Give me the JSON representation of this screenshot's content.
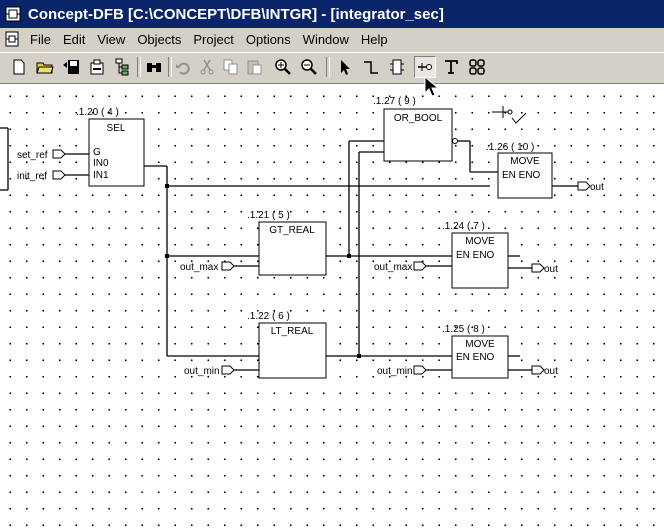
{
  "window": {
    "title": "Concept-DFB [C:\\CONCEPT\\DFB\\INTGR]  - [integrator_sec]"
  },
  "menu": [
    "File",
    "Edit",
    "View",
    "Objects",
    "Project",
    "Options",
    "Window",
    "Help"
  ],
  "toolbar": {
    "buttons": [
      "new-file-icon",
      "open-folder-icon",
      "save-icon",
      "print-setup-icon",
      "hierarchy-icon",
      "find-icon",
      "undo-icon",
      "cut-icon",
      "copy-icon",
      "paste-icon",
      "zoom-in-icon",
      "zoom-out-icon",
      "select-arrow-icon",
      "link-icon",
      "ffb-block-icon",
      "pin-icon",
      "text-icon",
      "grid-icon"
    ],
    "pressed": "pin-icon"
  },
  "blocks": {
    "sel": {
      "id": ".1.20 ( 4 )",
      "name": "SEL",
      "pins": [
        "G",
        "IN0",
        "IN1"
      ]
    },
    "or_bool": {
      "id": ".1.27 ( 9 )",
      "name": "OR_BOOL"
    },
    "move10": {
      "id": ".1.26 ( 10 )",
      "name": "MOVE",
      "pins": "EN ENO"
    },
    "gt_real": {
      "id": ".1.21 ( 5 )",
      "name": "GT_REAL"
    },
    "move7": {
      "id": ".1.24 ( 7 )",
      "name": "MOVE",
      "pins": "EN  ENO"
    },
    "lt_real": {
      "id": ".1.22 ( 6 )",
      "name": "LT_REAL"
    },
    "move8": {
      "id": ".1.25 ( 8 )",
      "name": "MOVE",
      "pins": "EN  ENO"
    }
  },
  "io": {
    "set_ref": "set_ref",
    "init_ref": "init_ref",
    "out_max_in1": "out_max",
    "out_max_in2": "out_max",
    "out_min_in1": "out_min",
    "out_min_in2": "out_min",
    "out1": "out",
    "out2": "out",
    "out3": "out"
  }
}
